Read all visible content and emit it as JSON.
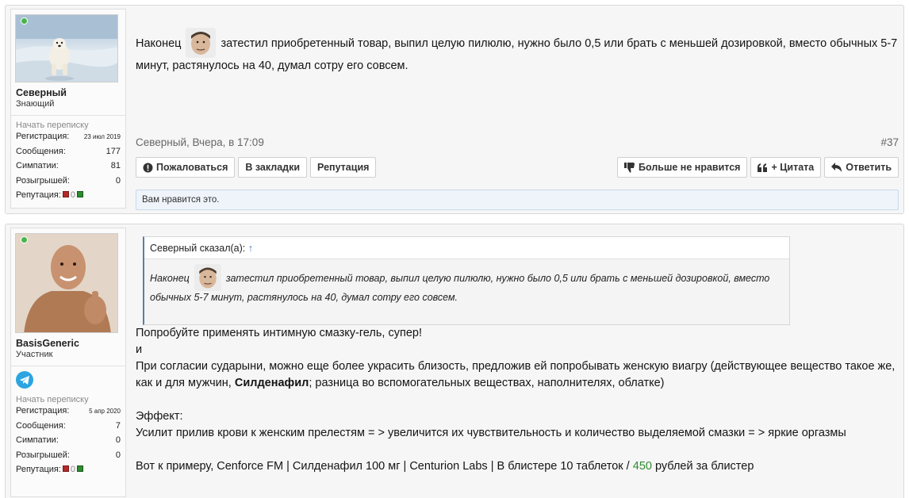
{
  "posts": [
    {
      "user": {
        "name": "Северный",
        "title": "Знающий",
        "start_conv": "Начать переписку",
        "stats": [
          {
            "label": "Регистрация:",
            "value": "23 июл 2019"
          },
          {
            "label": "Сообщения:",
            "value": "177"
          },
          {
            "label": "Симпатии:",
            "value": "81"
          },
          {
            "label": "Розыгрышей:",
            "value": "0"
          }
        ],
        "rep_label": "Репутация:",
        "rep_value": "0"
      },
      "message": {
        "before": "Наконец",
        "after": "затестил приобретенный товар, выпил целую пилюлю, нужно было 0,5 или брать с меньшей дозировкой, вместо обычных 5-7 минут, растянулось на 40, думал сотру его совсем."
      },
      "meta": {
        "author": "Северный",
        "time": ", Вчера, в 17:09",
        "number": "#37"
      },
      "buttons": {
        "report": "Пожаловаться",
        "bookmark": "В закладки",
        "reputation": "Репутация",
        "unlike": "Больше не нравится",
        "quote": "+ Цитата",
        "reply": "Ответить"
      },
      "likes_text": "Вам нравится это."
    },
    {
      "user": {
        "name": "BasisGeneric",
        "title": "Участник",
        "start_conv": "Начать переписку",
        "stats": [
          {
            "label": "Регистрация:",
            "value": "5 апр 2020"
          },
          {
            "label": "Сообщения:",
            "value": "7"
          },
          {
            "label": "Симпатии:",
            "value": "0"
          },
          {
            "label": "Розыгрышей:",
            "value": "0"
          }
        ],
        "rep_label": "Репутация:",
        "rep_value": "0"
      },
      "quote": {
        "author": "Северный сказал(а):",
        "arrow": "↑",
        "before": "Наконец",
        "after": "затестил приобретенный товар, выпил целую пилюлю, нужно было 0,5 или брать с меньшей дозировкой, вместо обычных 5-7 минут, растянулось на 40, думал сотру его совсем."
      },
      "message": {
        "line1": "Попробуйте применять интимную смазку-гель, супер!",
        "line2": "и",
        "para_before": "При согласии сударыни, можно еще более украсить близость, предложив ей попробывать женскую виагру (действующее вещество такое же, как и для мужчин, ",
        "para_bold": "Силденафил",
        "para_after": "; разница во вспомогательных веществах, наполнителях, облатке)",
        "effect_label": "Эффект:",
        "effect_text": "Усилит прилив крови к женским прелестям = > увеличится их чувствительность и количество выделяемой смазки = > яркие оргазмы",
        "example_before": "Вот к примеру, Cenforce FM | Силденафил 100 мг | Centurion Labs | В блистере 10 таблеток / ",
        "example_price": "450",
        "example_after": " рублей за блистер"
      }
    }
  ],
  "colors": {
    "online": "#47b54a",
    "price": "#2f8c2f",
    "quote_border": "#5b7ea6",
    "telegram": "#2ca5e0"
  },
  "icons": [
    "online-indicator-icon",
    "alert-circle-icon",
    "thumbs-down-icon",
    "quote-icon",
    "reply-arrow-icon",
    "telegram-icon",
    "smiley-icon"
  ]
}
